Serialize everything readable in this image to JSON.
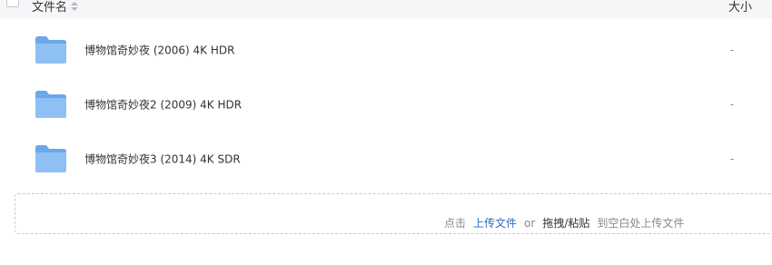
{
  "header": {
    "name_label": "文件名",
    "size_label": "大小"
  },
  "files": [
    {
      "name": "博物馆奇妙夜 (2006) 4K HDR",
      "size": "-",
      "icon": "folder-icon"
    },
    {
      "name": "博物馆奇妙夜2 (2009) 4K HDR",
      "size": "-",
      "icon": "folder-icon"
    },
    {
      "name": "博物馆奇妙夜3 (2014) 4K SDR",
      "size": "-",
      "icon": "folder-icon"
    }
  ],
  "upload": {
    "prefix": "点击",
    "link": "上传文件",
    "or": "or",
    "drag": "拖拽/粘贴",
    "suffix": "到空白处上传文件"
  },
  "colors": {
    "header_bg": "#f5f6f7",
    "link": "#2d69c4",
    "folder_light": "#8fc0f3",
    "folder_dark": "#6aa8ec"
  }
}
